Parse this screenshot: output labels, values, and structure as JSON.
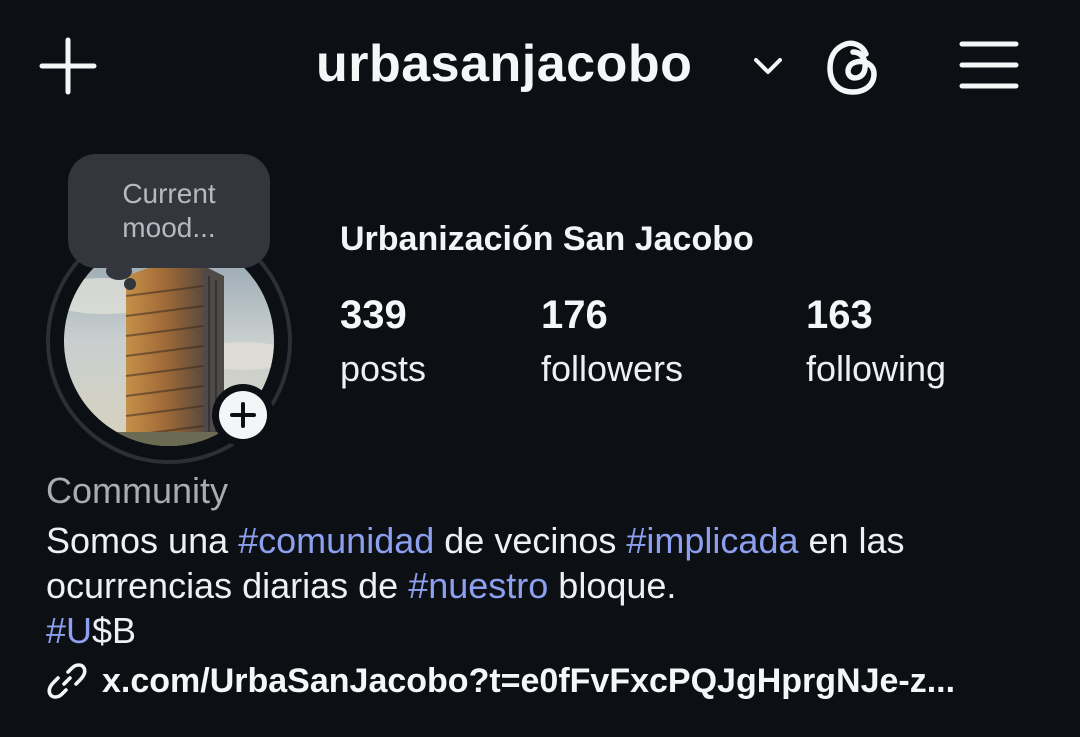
{
  "header": {
    "username": "urbasanjacobo",
    "icons": [
      "plus-icon",
      "chevron-down-icon",
      "threads-icon",
      "menu-icon"
    ]
  },
  "note": {
    "line1": "Current",
    "line2": "mood..."
  },
  "profile": {
    "display_name": "Urbanización San Jacobo",
    "stats": {
      "posts": {
        "value": "339",
        "label": "posts"
      },
      "followers": {
        "value": "176",
        "label": "followers"
      },
      "following": {
        "value": "163",
        "label": "following"
      }
    },
    "category": "Community",
    "bio": {
      "line1": [
        {
          "text": "Somos una ",
          "tag": false
        },
        {
          "text": "#comunidad",
          "tag": true
        },
        {
          "text": " de vecinos ",
          "tag": false
        },
        {
          "text": "#implicada",
          "tag": true
        },
        {
          "text": " en las",
          "tag": false
        }
      ],
      "line2": [
        {
          "text": "ocurrencias diarias de ",
          "tag": false
        },
        {
          "text": "#nuestro",
          "tag": true
        },
        {
          "text": " bloque.",
          "tag": false
        }
      ],
      "line3": [
        {
          "text": "#U",
          "tag": true
        },
        {
          "text": "$B",
          "tag": false
        }
      ]
    },
    "link": "x.com/UrbaSanJacobo?t=e0fFvFxcPQJgHprgNJe-z..."
  },
  "colors": {
    "background": "#0c0f14",
    "hashtag": "#8da0f0",
    "secondary_text": "#a9acb3",
    "note_bubble": "#33363d"
  }
}
